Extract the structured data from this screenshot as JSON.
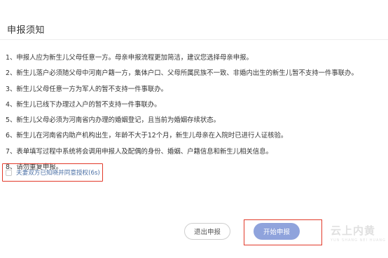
{
  "page": {
    "title": "申报须知"
  },
  "rules": [
    "1、申报人应为新生儿父母任意一方。母亲申报流程更加简洁，建议您选择母亲申报。",
    "2、新生儿落户必须随父母中河南户籍一方，集体户口、父母所属民族不一致、非婚内出生的新生儿暂不支持一件事联办。",
    "3、新生儿父母任意一方为军人的暂不支持一件事联办。",
    "4、新生儿已线下办理过入户的暂不支持一件事联办。",
    "5、新生儿父母必须为河南省内办理的婚姻登记，且当前为婚姻存续状态。",
    "6、新生儿在河南省内助产机构出生，年龄不大于12个月，新生儿母亲在入院时已进行人证核验。",
    "7、表单填写过程中系统将会调用申报人及配偶的身份、婚姻、户籍信息和新生儿相关信息。",
    "8、请勿重复申报。"
  ],
  "consent": {
    "label": "夫妻双方已知晓并同意授权(6s)",
    "checked": false
  },
  "buttons": {
    "exit": "退出申报",
    "start": "开始申报"
  },
  "watermark": {
    "text_cn": "云上内黄",
    "text_en": "YUN SHANG NEI HUANG"
  },
  "colors": {
    "highlight_frame": "#e23a2a",
    "start_button": "#8fa3dc",
    "consent_text": "#4a6fa5"
  }
}
